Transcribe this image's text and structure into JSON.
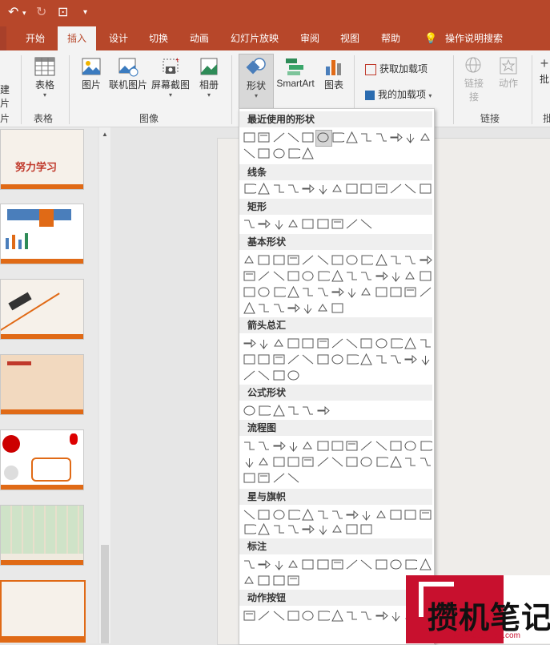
{
  "qat": {
    "undo": "↶",
    "redo": "↻",
    "present": "⊡",
    "custom": "₹"
  },
  "tabs": [
    {
      "label": "开始"
    },
    {
      "label": "插入"
    },
    {
      "label": "设计"
    },
    {
      "label": "切换"
    },
    {
      "label": "动画"
    },
    {
      "label": "幻灯片放映"
    },
    {
      "label": "审阅"
    },
    {
      "label": "视图"
    },
    {
      "label": "帮助"
    }
  ],
  "tell_me": "操作说明搜索",
  "ribbon": {
    "new_slide_partial_1": "建",
    "new_slide_partial_2": "片",
    "slides_group_partial": "片",
    "table": "表格",
    "table_group": "表格",
    "pictures": "图片",
    "online_pictures": "联机图片",
    "screenshot": "屏幕截图",
    "album": "相册",
    "images_group": "图像",
    "shapes": "形状",
    "smartart": "SmartArt",
    "chart": "图表",
    "get_addins": "获取加载项",
    "my_addins": "我的加载项",
    "link": "链接",
    "link_l2": "接",
    "action": "动作",
    "links_group": "链接",
    "cut_group": "批"
  },
  "thumbs": {
    "t1_title": "努力学习"
  },
  "gallery": {
    "sections": [
      {
        "title": "最近使用的形状"
      },
      {
        "title": "线条"
      },
      {
        "title": "矩形"
      },
      {
        "title": "基本形状"
      },
      {
        "title": "箭头总汇"
      },
      {
        "title": "公式形状"
      },
      {
        "title": "流程图"
      },
      {
        "title": "星与旗帜"
      },
      {
        "title": "标注"
      },
      {
        "title": "动作按钮"
      }
    ]
  },
  "watermark": {
    "brand": "攒机笔记",
    "url": "www.cuanjibiji.com"
  },
  "colors": {
    "accent": "#b7472a",
    "orange": "#e06a16"
  }
}
